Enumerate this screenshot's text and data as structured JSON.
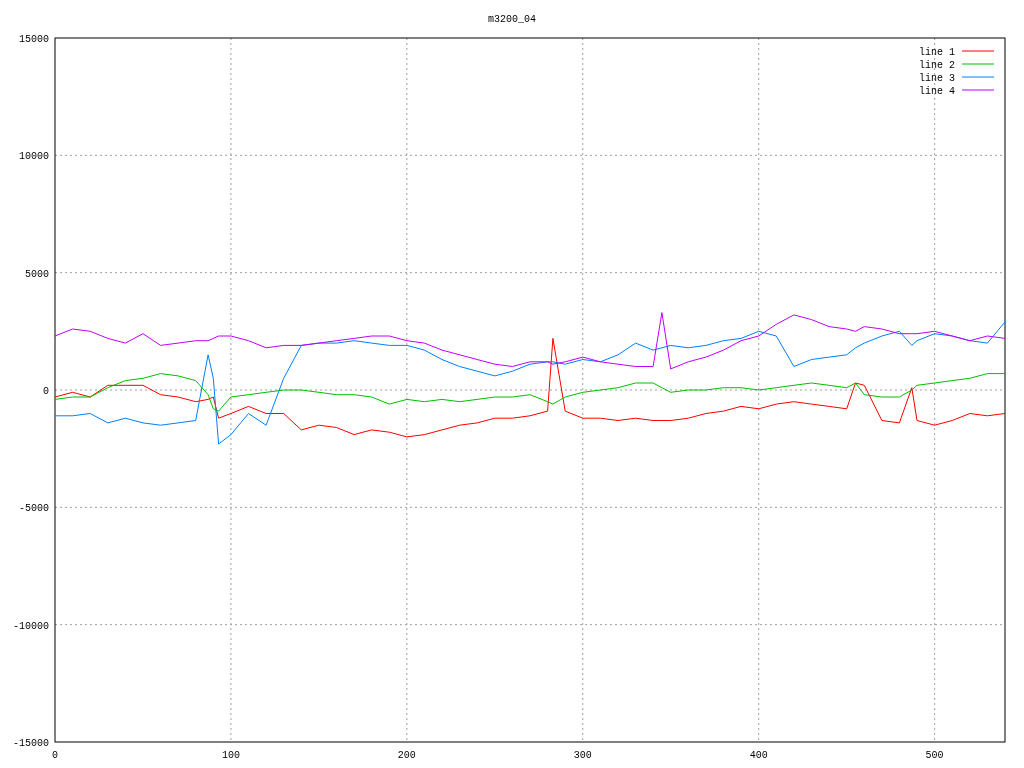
{
  "chart_data": {
    "type": "line",
    "title": "m3200_04",
    "x": [
      0,
      10,
      20,
      30,
      40,
      50,
      60,
      70,
      80,
      87,
      90,
      93,
      100,
      110,
      120,
      130,
      140,
      150,
      160,
      170,
      180,
      190,
      200,
      210,
      220,
      230,
      240,
      250,
      260,
      270,
      280,
      283,
      290,
      300,
      310,
      320,
      330,
      340,
      345,
      350,
      360,
      370,
      380,
      390,
      400,
      410,
      420,
      430,
      440,
      450,
      455,
      460,
      470,
      480,
      487,
      490,
      500,
      510,
      520,
      530,
      540
    ],
    "series": [
      {
        "name": "line 1",
        "color": "#ff0000",
        "values": [
          -300,
          -100,
          -300,
          200,
          200,
          200,
          -200,
          -300,
          -500,
          -400,
          -300,
          -1200,
          -1000,
          -700,
          -1000,
          -1000,
          -1700,
          -1500,
          -1600,
          -1900,
          -1700,
          -1800,
          -2000,
          -1900,
          -1700,
          -1500,
          -1400,
          -1200,
          -1200,
          -1100,
          -900,
          2200,
          -900,
          -1200,
          -1200,
          -1300,
          -1200,
          -1300,
          -1300,
          -1300,
          -1200,
          -1000,
          -900,
          -700,
          -800,
          -600,
          -500,
          -600,
          -700,
          -800,
          300,
          200,
          -1300,
          -1400,
          100,
          -1300,
          -1500,
          -1300,
          -1000,
          -1100,
          -1000
        ]
      },
      {
        "name": "line 2",
        "color": "#00c000",
        "values": [
          -400,
          -300,
          -300,
          100,
          400,
          500,
          700,
          600,
          400,
          -200,
          -800,
          -900,
          -300,
          -200,
          -100,
          0,
          0,
          -100,
          -200,
          -200,
          -300,
          -600,
          -400,
          -500,
          -400,
          -500,
          -400,
          -300,
          -300,
          -200,
          -500,
          -600,
          -300,
          -100,
          0,
          100,
          300,
          300,
          100,
          -100,
          0,
          0,
          100,
          100,
          0,
          100,
          200,
          300,
          200,
          100,
          300,
          -200,
          -300,
          -300,
          0,
          200,
          300,
          400,
          500,
          700,
          700
        ]
      },
      {
        "name": "line 3",
        "color": "#0080ff",
        "values": [
          -1100,
          -1100,
          -1000,
          -1400,
          -1200,
          -1400,
          -1500,
          -1400,
          -1300,
          1500,
          500,
          -2300,
          -1900,
          -1000,
          -1500,
          500,
          1900,
          2000,
          2000,
          2100,
          2000,
          1900,
          1900,
          1700,
          1300,
          1000,
          800,
          600,
          800,
          1100,
          1200,
          1200,
          1100,
          1300,
          1200,
          1500,
          2000,
          1700,
          1800,
          1900,
          1800,
          1900,
          2100,
          2200,
          2500,
          2300,
          1000,
          1300,
          1400,
          1500,
          1800,
          2000,
          2300,
          2500,
          1900,
          2100,
          2400,
          2300,
          2100,
          2000,
          2900
        ]
      },
      {
        "name": "line 4",
        "color": "#c000ff",
        "values": [
          2300,
          2600,
          2500,
          2200,
          2000,
          2400,
          1900,
          2000,
          2100,
          2100,
          2200,
          2300,
          2300,
          2100,
          1800,
          1900,
          1900,
          2000,
          2100,
          2200,
          2300,
          2300,
          2100,
          2000,
          1700,
          1500,
          1300,
          1100,
          1000,
          1200,
          1200,
          1100,
          1200,
          1400,
          1200,
          1100,
          1000,
          1000,
          3300,
          900,
          1200,
          1400,
          1700,
          2100,
          2300,
          2800,
          3200,
          3000,
          2700,
          2600,
          2500,
          2700,
          2600,
          2400,
          2400,
          2400,
          2500,
          2300,
          2100,
          2300,
          2200
        ]
      }
    ],
    "xlim": [
      0,
      540
    ],
    "ylim": [
      -15000,
      15000
    ],
    "xticks": [
      0,
      100,
      200,
      300,
      400,
      500
    ],
    "yticks": [
      -15000,
      -10000,
      -5000,
      0,
      5000,
      10000,
      15000
    ],
    "grid": true,
    "legend": true
  }
}
